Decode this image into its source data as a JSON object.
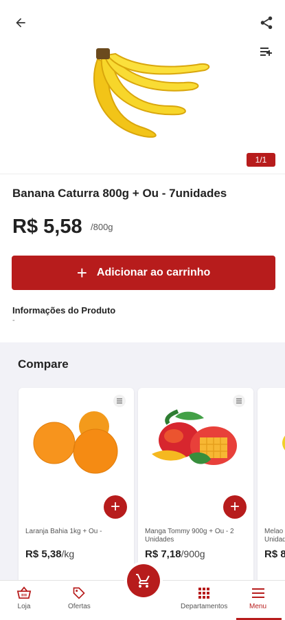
{
  "product": {
    "title": "Banana Caturra 800g + Ou - 7unidades",
    "price": "R$ 5,58",
    "unit": "/800g",
    "pager": "1/1",
    "add_to_cart_label": "Adicionar ao carrinho",
    "info_title": "Informações do Produto",
    "info_text": "-"
  },
  "compare": {
    "title": "Compare",
    "items": [
      {
        "name": "Laranja Bahia 1kg + Ou -",
        "price": "R$ 5,38",
        "unit": "/kg"
      },
      {
        "name": "Manga Tommy 900g + Ou - 2 Unidades",
        "price": "R$ 7,18",
        "unit": "/900g"
      },
      {
        "name": "Melao Unidad",
        "price": "R$ 8",
        "unit": ""
      }
    ]
  },
  "bottom_nav": {
    "items": [
      {
        "label": "Loja",
        "icon": "basket-icon"
      },
      {
        "label": "Ofertas",
        "icon": "tag-icon"
      },
      {
        "label": "Departamentos",
        "icon": "grid-icon"
      },
      {
        "label": "Menu",
        "icon": "menu-icon"
      }
    ],
    "active": "Menu"
  },
  "colors": {
    "accent": "#b71c1c",
    "compare_background": "#f2f2f7"
  }
}
